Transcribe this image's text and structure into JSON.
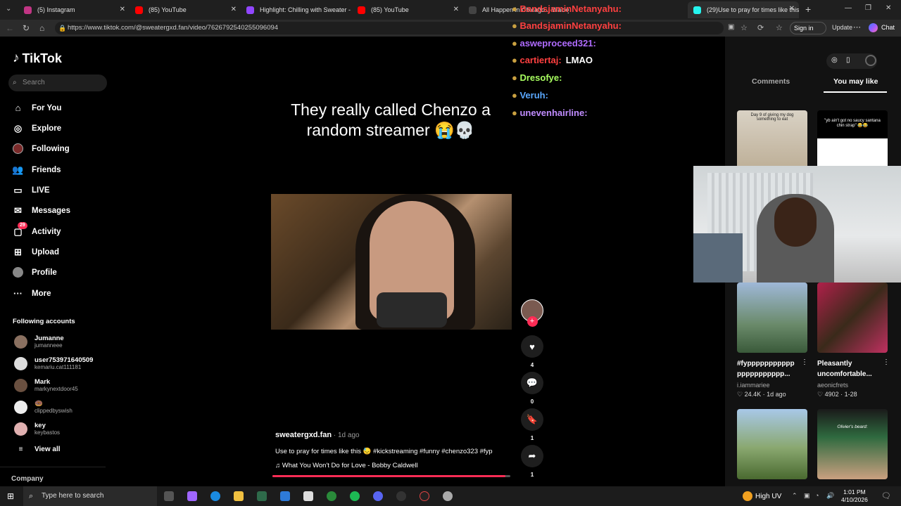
{
  "browser": {
    "tabs": [
      {
        "label": "(5) Instagram",
        "color": "#c13584"
      },
      {
        "label": "(85) YouTube",
        "color": "#ff0000"
      },
      {
        "label": "Highlight: Chilling with Sweater - T",
        "color": "#9146ff"
      },
      {
        "label": "(85) YouTube",
        "color": "#ff0000"
      },
      {
        "label": "All Happen in Chicago... Wacky Loot",
        "color": "#444444"
      },
      {
        "label": "(29)Use to pray for times like this",
        "color": "#25f4ee"
      }
    ],
    "url": "https://www.tiktok.com/@sweatergxd.fan/video/7626792540255096094",
    "sign_in": "Sign in",
    "update": "Update",
    "chat": "Chat"
  },
  "sidebar": {
    "logo": "TikTok",
    "search_placeholder": "Search",
    "nav": [
      {
        "label": "For You",
        "icon": "home-icon"
      },
      {
        "label": "Explore",
        "icon": "compass-icon"
      },
      {
        "label": "Following",
        "icon": "following-avatar-icon"
      },
      {
        "label": "Friends",
        "icon": "friends-icon"
      },
      {
        "label": "LIVE",
        "icon": "live-icon"
      },
      {
        "label": "Messages",
        "icon": "messages-icon"
      },
      {
        "label": "Activity",
        "icon": "activity-icon",
        "badge": "29"
      },
      {
        "label": "Upload",
        "icon": "upload-icon"
      },
      {
        "label": "Profile",
        "icon": "profile-icon"
      },
      {
        "label": "More",
        "icon": "more-icon"
      }
    ],
    "following_title": "Following accounts",
    "accounts": [
      {
        "name": "Jumanne",
        "handle": "jumanneee"
      },
      {
        "name": "user753971640509",
        "handle": "kemariu.cat111181"
      },
      {
        "name": "Mark",
        "handle": "markynextdoor45"
      },
      {
        "name": "🍩",
        "handle": "clippedbyswish"
      },
      {
        "name": "key",
        "handle": "keybastos"
      }
    ],
    "view_all": "View all",
    "company": "Company"
  },
  "stream_chat": [
    {
      "user": "BandsjaminNetanyahu:",
      "msg": "",
      "color": "#ff4040"
    },
    {
      "user": "BandsjaminNetanyahu:",
      "msg": "",
      "color": "#ff4040"
    },
    {
      "user": "asweproceed321:",
      "msg": "",
      "color": "#b06cff"
    },
    {
      "user": "cartiertaj:",
      "msg": "LMAO",
      "color": "#ff4040"
    },
    {
      "user": "Dresofye:",
      "msg": "",
      "color": "#a8ff60"
    },
    {
      "user": "Veruh:",
      "msg": "",
      "color": "#5aa8ff"
    },
    {
      "user": "unevenhairline:",
      "msg": "",
      "color": "#c08cff"
    }
  ],
  "video": {
    "caption": "They really called Chenzo a random streamer 😭💀",
    "author": "sweatergxd.fan",
    "age": " · 1d ago",
    "description": "Use to pray for times like this 😓 #kickstreaming #funny #chenzo323 #fyp",
    "music": "♫  What You Won't Do for Love - Bobby Caldwell",
    "progress": 0.98,
    "likes": "4",
    "comments": "0",
    "saves": "1",
    "shares": "1"
  },
  "right_panel": {
    "tabs": [
      "Comments",
      "You may like"
    ],
    "thumb_texts": [
      "Day 9 of giving my dog something to eat",
      "\"yb ain't got no saucy santana chin strap\" 😂😂"
    ],
    "videos": [
      {
        "title1": "#fyppppppppppp",
        "title2": "ppppppppppp...",
        "user": "i.iammariee",
        "likes": "♡ 24.4K",
        "age": "· 1d ago"
      },
      {
        "title1": "Pleasantly",
        "title2": "uncomfortable...",
        "user": "aeonicfrets",
        "likes": "♡ 4902",
        "age": "· 1-28"
      }
    ],
    "bottom_caption": "Olivier's beard:"
  },
  "taskbar": {
    "search": "Type here to search",
    "weather": "High UV",
    "time": "1:01 PM",
    "date": "4/10/2026"
  }
}
